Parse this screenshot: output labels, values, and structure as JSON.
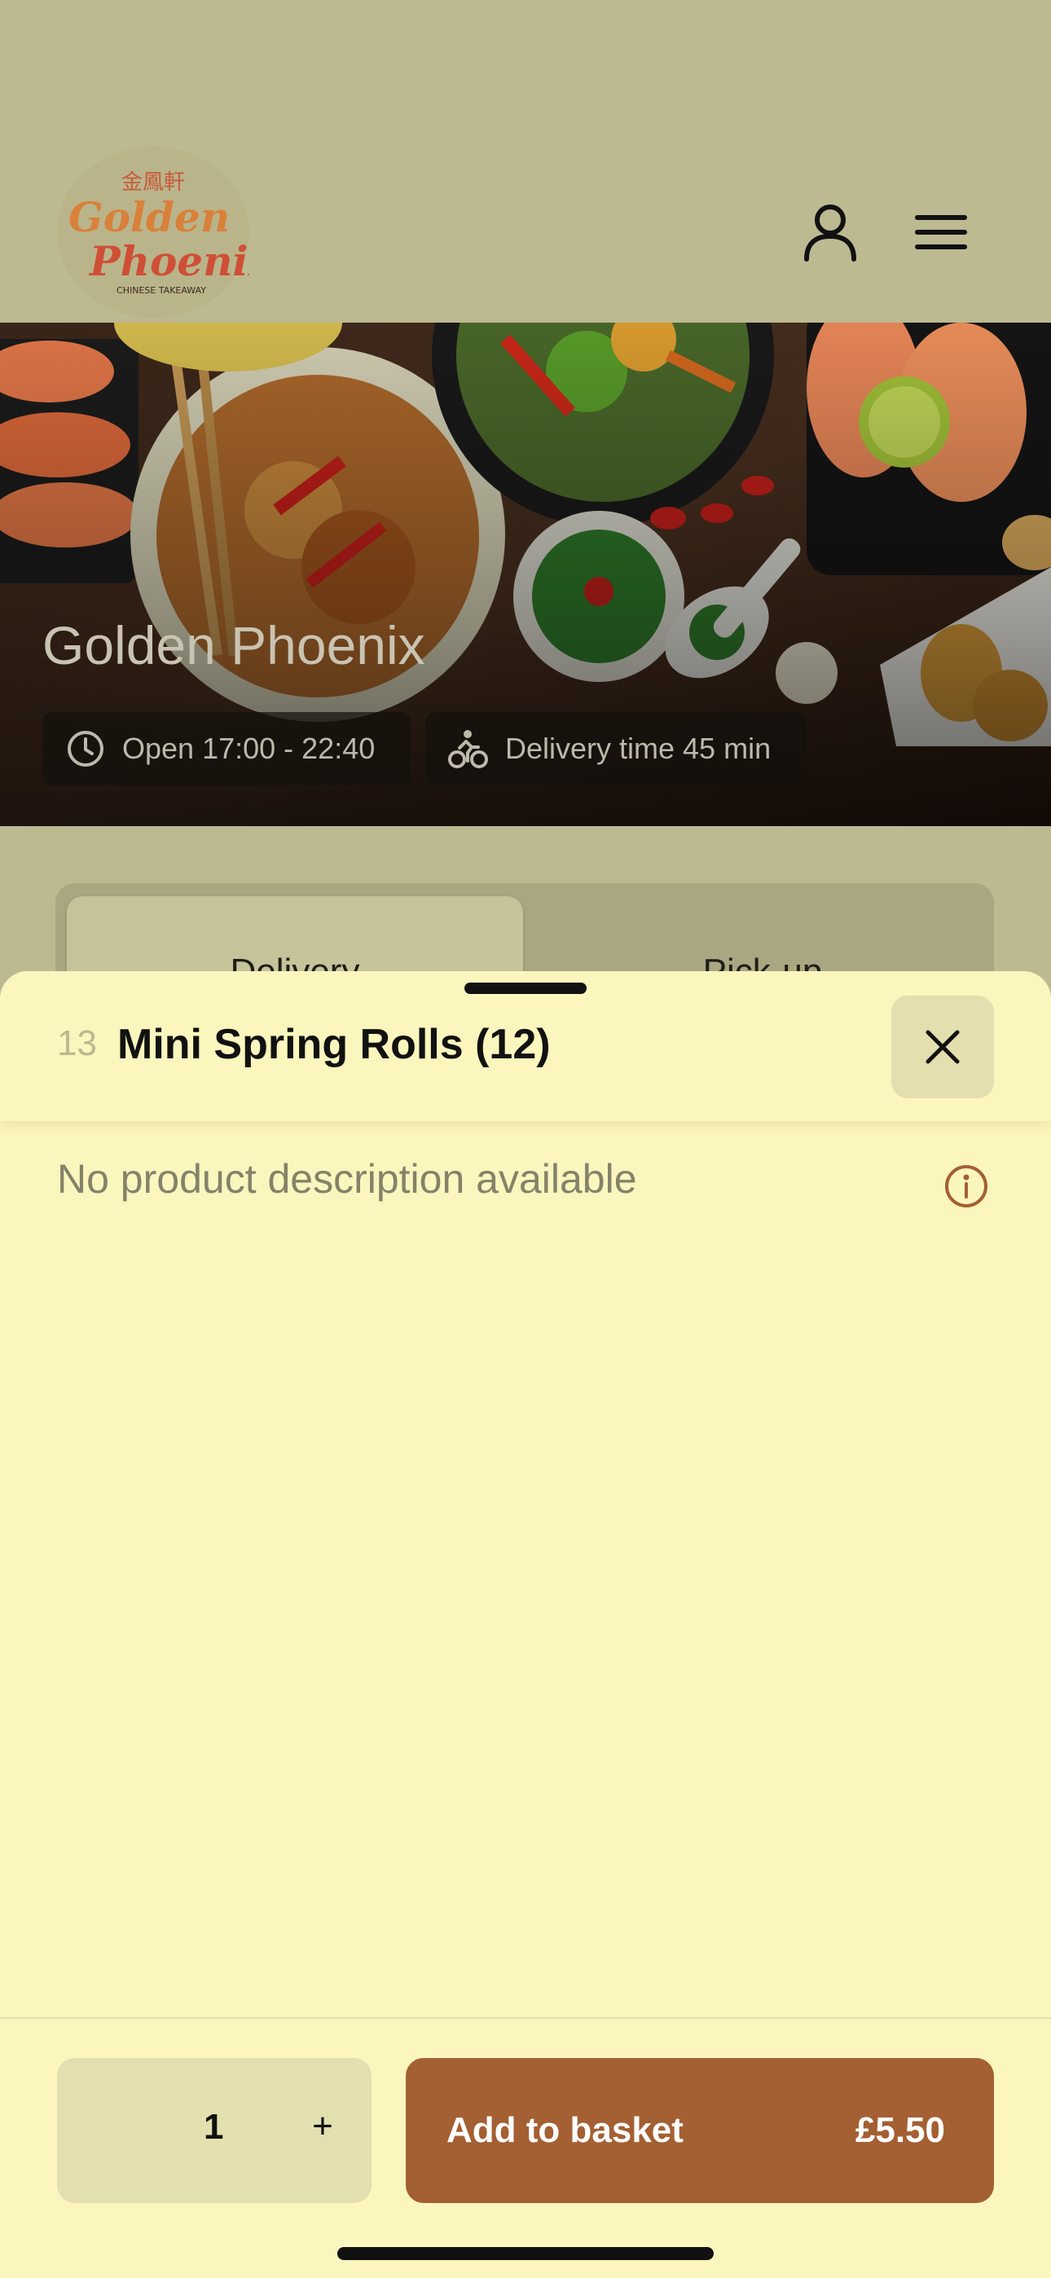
{
  "header": {
    "logo": {
      "chinese": "金鳳軒",
      "line1": "Golden",
      "line2": "Phoenix",
      "tagline": "CHINESE TAKEAWAY"
    },
    "icons": {
      "account": "user-icon",
      "menu": "hamburger-menu-icon"
    }
  },
  "hero": {
    "title": "Golden Phoenix",
    "opening_hours": "Open 17:00 - 22:40",
    "delivery_time": "Delivery time 45 min"
  },
  "order_type": {
    "options": [
      "Delivery",
      "Pick-up"
    ],
    "selected": "Delivery"
  },
  "product": {
    "number": "13",
    "name": "Mini Spring Rolls (12)",
    "description": "No product description available"
  },
  "footer": {
    "quantity": "1",
    "plus_label": "+",
    "add_label": "Add to basket",
    "price": "£5.50"
  },
  "colors": {
    "accent": "#a45f32",
    "sheet_background": "#fbf6bd",
    "header_background": "#bdb991",
    "control_background": "#e3dfae"
  }
}
